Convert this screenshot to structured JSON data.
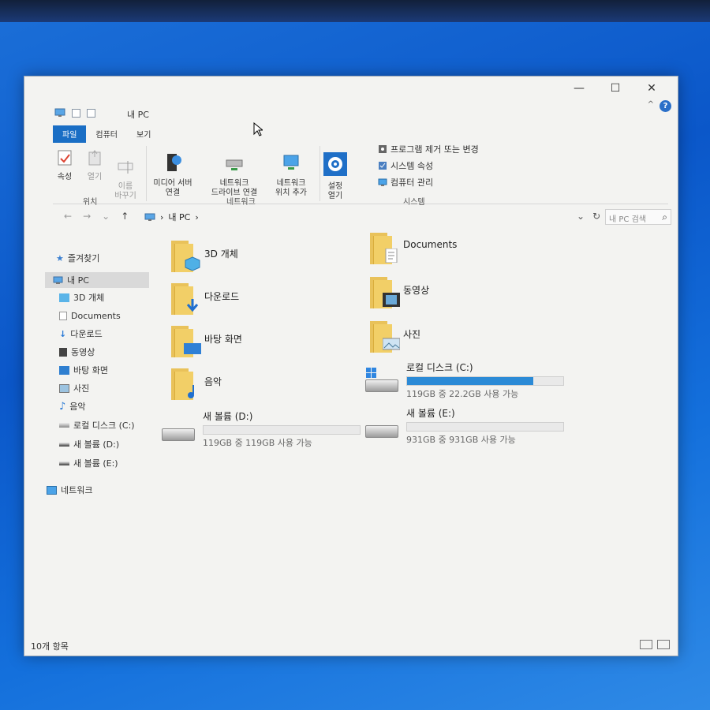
{
  "window": {
    "title": "내 PC",
    "controls": {
      "minimize": "—",
      "maximize": "☐",
      "close": "✕"
    },
    "help": "?",
    "collapse": "^"
  },
  "ribbon": {
    "tabs": [
      "파일",
      "컴퓨터",
      "보기"
    ],
    "location_group": {
      "label": "위치",
      "buttons": [
        "속성",
        "열기",
        "이름\n바꾸기"
      ]
    },
    "network_group": {
      "label": "네트워크",
      "buttons": [
        "미디어 서버\n연결",
        "네트워크\n드라이브 연결",
        "네트워크\n위치 추가"
      ]
    },
    "settings_button": "설정\n열기",
    "system_group": {
      "label": "시스템",
      "items": [
        "프로그램 제거 또는 변경",
        "시스템 속성",
        "컴퓨터 관리"
      ]
    }
  },
  "address": {
    "back": "←",
    "forward": "→",
    "up": "↑",
    "crumbs": [
      "내 PC"
    ],
    "separator": "›",
    "search_placeholder": "내 PC 검색"
  },
  "navpane": {
    "quick_access": "즐겨찾기",
    "this_pc": "내 PC",
    "items": [
      "3D 개체",
      "Documents",
      "다운로드",
      "동영상",
      "바탕 화면",
      "사진",
      "음악",
      "로컬 디스크 (C:)",
      "새 볼륨 (D:)",
      "새 볼륨 (E:)"
    ],
    "network": "네트워크"
  },
  "folders": {
    "left": [
      "3D 개체",
      "다운로드",
      "바탕 화면",
      "음악"
    ],
    "right": [
      "Documents",
      "동영상",
      "사진"
    ]
  },
  "drives": [
    {
      "name": "로컬 디스크 (C:)",
      "free": "119GB 중 22.2GB 사용 가능",
      "used_fraction": 0.81
    },
    {
      "name": "새 볼륨 (D:)",
      "free": "119GB 중 119GB 사용 가능",
      "used_fraction": 0.0
    },
    {
      "name": "새 볼륨 (E:)",
      "free": "931GB 중 931GB 사용 가능",
      "used_fraction": 0.0
    }
  ],
  "status": {
    "count": "10개 항목"
  },
  "colors": {
    "accent": "#1a6ec5",
    "bar_fill": "#2b8ad6",
    "folder": "#f2cf67"
  }
}
